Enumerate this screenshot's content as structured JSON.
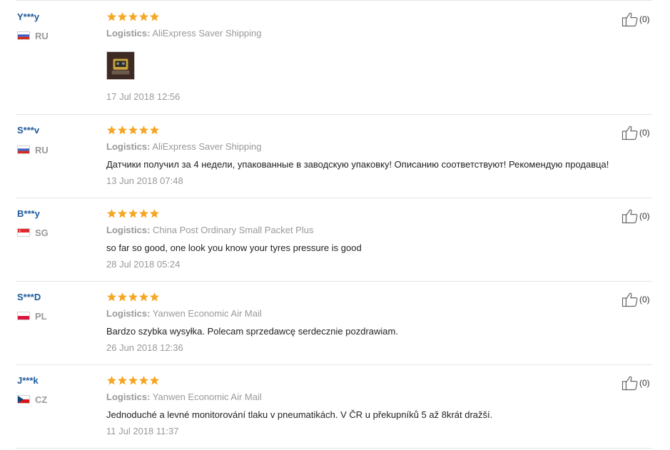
{
  "colors": {
    "star": "#f5a623",
    "username": "#1c5a9b",
    "muted": "#999999"
  },
  "logistics_label": "Logistics:",
  "reviews": [
    {
      "user": "Y***y",
      "country": "RU",
      "flag": "ru-flag-icon",
      "stars": 5,
      "logistics": "AliExpress Saver Shipping",
      "text": "",
      "has_photo": true,
      "date": "17 Jul 2018 12:56",
      "helpful": "(0)"
    },
    {
      "user": "S***v",
      "country": "RU",
      "flag": "ru-flag-icon",
      "stars": 5,
      "logistics": "AliExpress Saver Shipping",
      "text": "Датчики получил за 4 недели, упакованные в заводскую упаковку! Описанию соответствуют! Рекомендую продавца!",
      "date": "13 Jun 2018 07:48",
      "helpful": "(0)"
    },
    {
      "user": "B***y",
      "country": "SG",
      "flag": "sg-flag-icon",
      "stars": 5,
      "logistics": "China Post Ordinary Small Packet Plus",
      "text": "so far so good, one look you know your tyres pressure is good",
      "date": "28 Jul 2018 05:24",
      "helpful": "(0)"
    },
    {
      "user": "S***D",
      "country": "PL",
      "flag": "pl-flag-icon",
      "stars": 5,
      "logistics": "Yanwen Economic Air Mail",
      "text": "Bardzo szybka wysyłka. Polecam sprzedawcę serdecznie pozdrawiam.",
      "date": "26 Jun 2018 12:36",
      "helpful": "(0)"
    },
    {
      "user": "J***k",
      "country": "CZ",
      "flag": "cz-flag-icon",
      "stars": 5,
      "logistics": "Yanwen Economic Air Mail",
      "text": "Jednoduché a levné monitorování tlaku v pneumatikách. V ČR u překupníků 5 až 8krát dražší.",
      "date": "11 Jul 2018 11:37",
      "helpful": "(0)"
    }
  ]
}
